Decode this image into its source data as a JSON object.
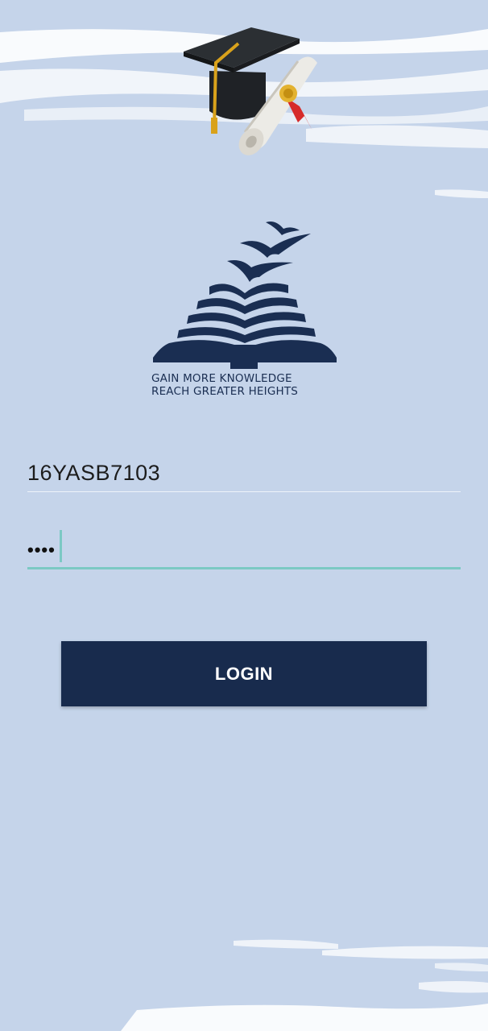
{
  "brand": {
    "tagline_line1": "GAIN  MORE  KNOWLEDGE",
    "tagline_line2": "REACH GREATER HEIGHTS",
    "navy": "#1a2e52"
  },
  "form": {
    "username_value": "16YASB7103",
    "password_masked": "••••",
    "login_label": "LOGIN",
    "accent": "#7cc9c4"
  },
  "icons": [
    "graduation-cap-icon",
    "diploma-scroll-icon",
    "open-book-birds-logo"
  ],
  "background": "#c5d4ea"
}
